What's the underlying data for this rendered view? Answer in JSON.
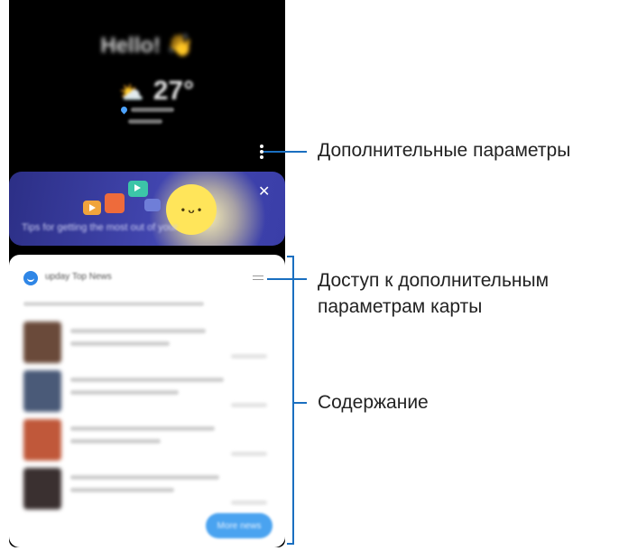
{
  "screen": {
    "greeting": "Hello!",
    "wave_emoji": "👋",
    "weather_icon": "partly-cloudy",
    "temperature": "27°",
    "promo": {
      "text": "Tips for getting the most out of your",
      "close": "✕"
    },
    "news_card": {
      "title": "upday Top News",
      "more_button": "More news"
    }
  },
  "annotations": {
    "more_options": "Дополнительные параметры",
    "card_options_line1": "Доступ к дополнительным",
    "card_options_line2": "параметрам карты",
    "content": "Содержание"
  },
  "colors": {
    "accent": "#1a6fc0",
    "promo_bg": "#3a3ea8",
    "news_button": "#4aa3f0"
  }
}
